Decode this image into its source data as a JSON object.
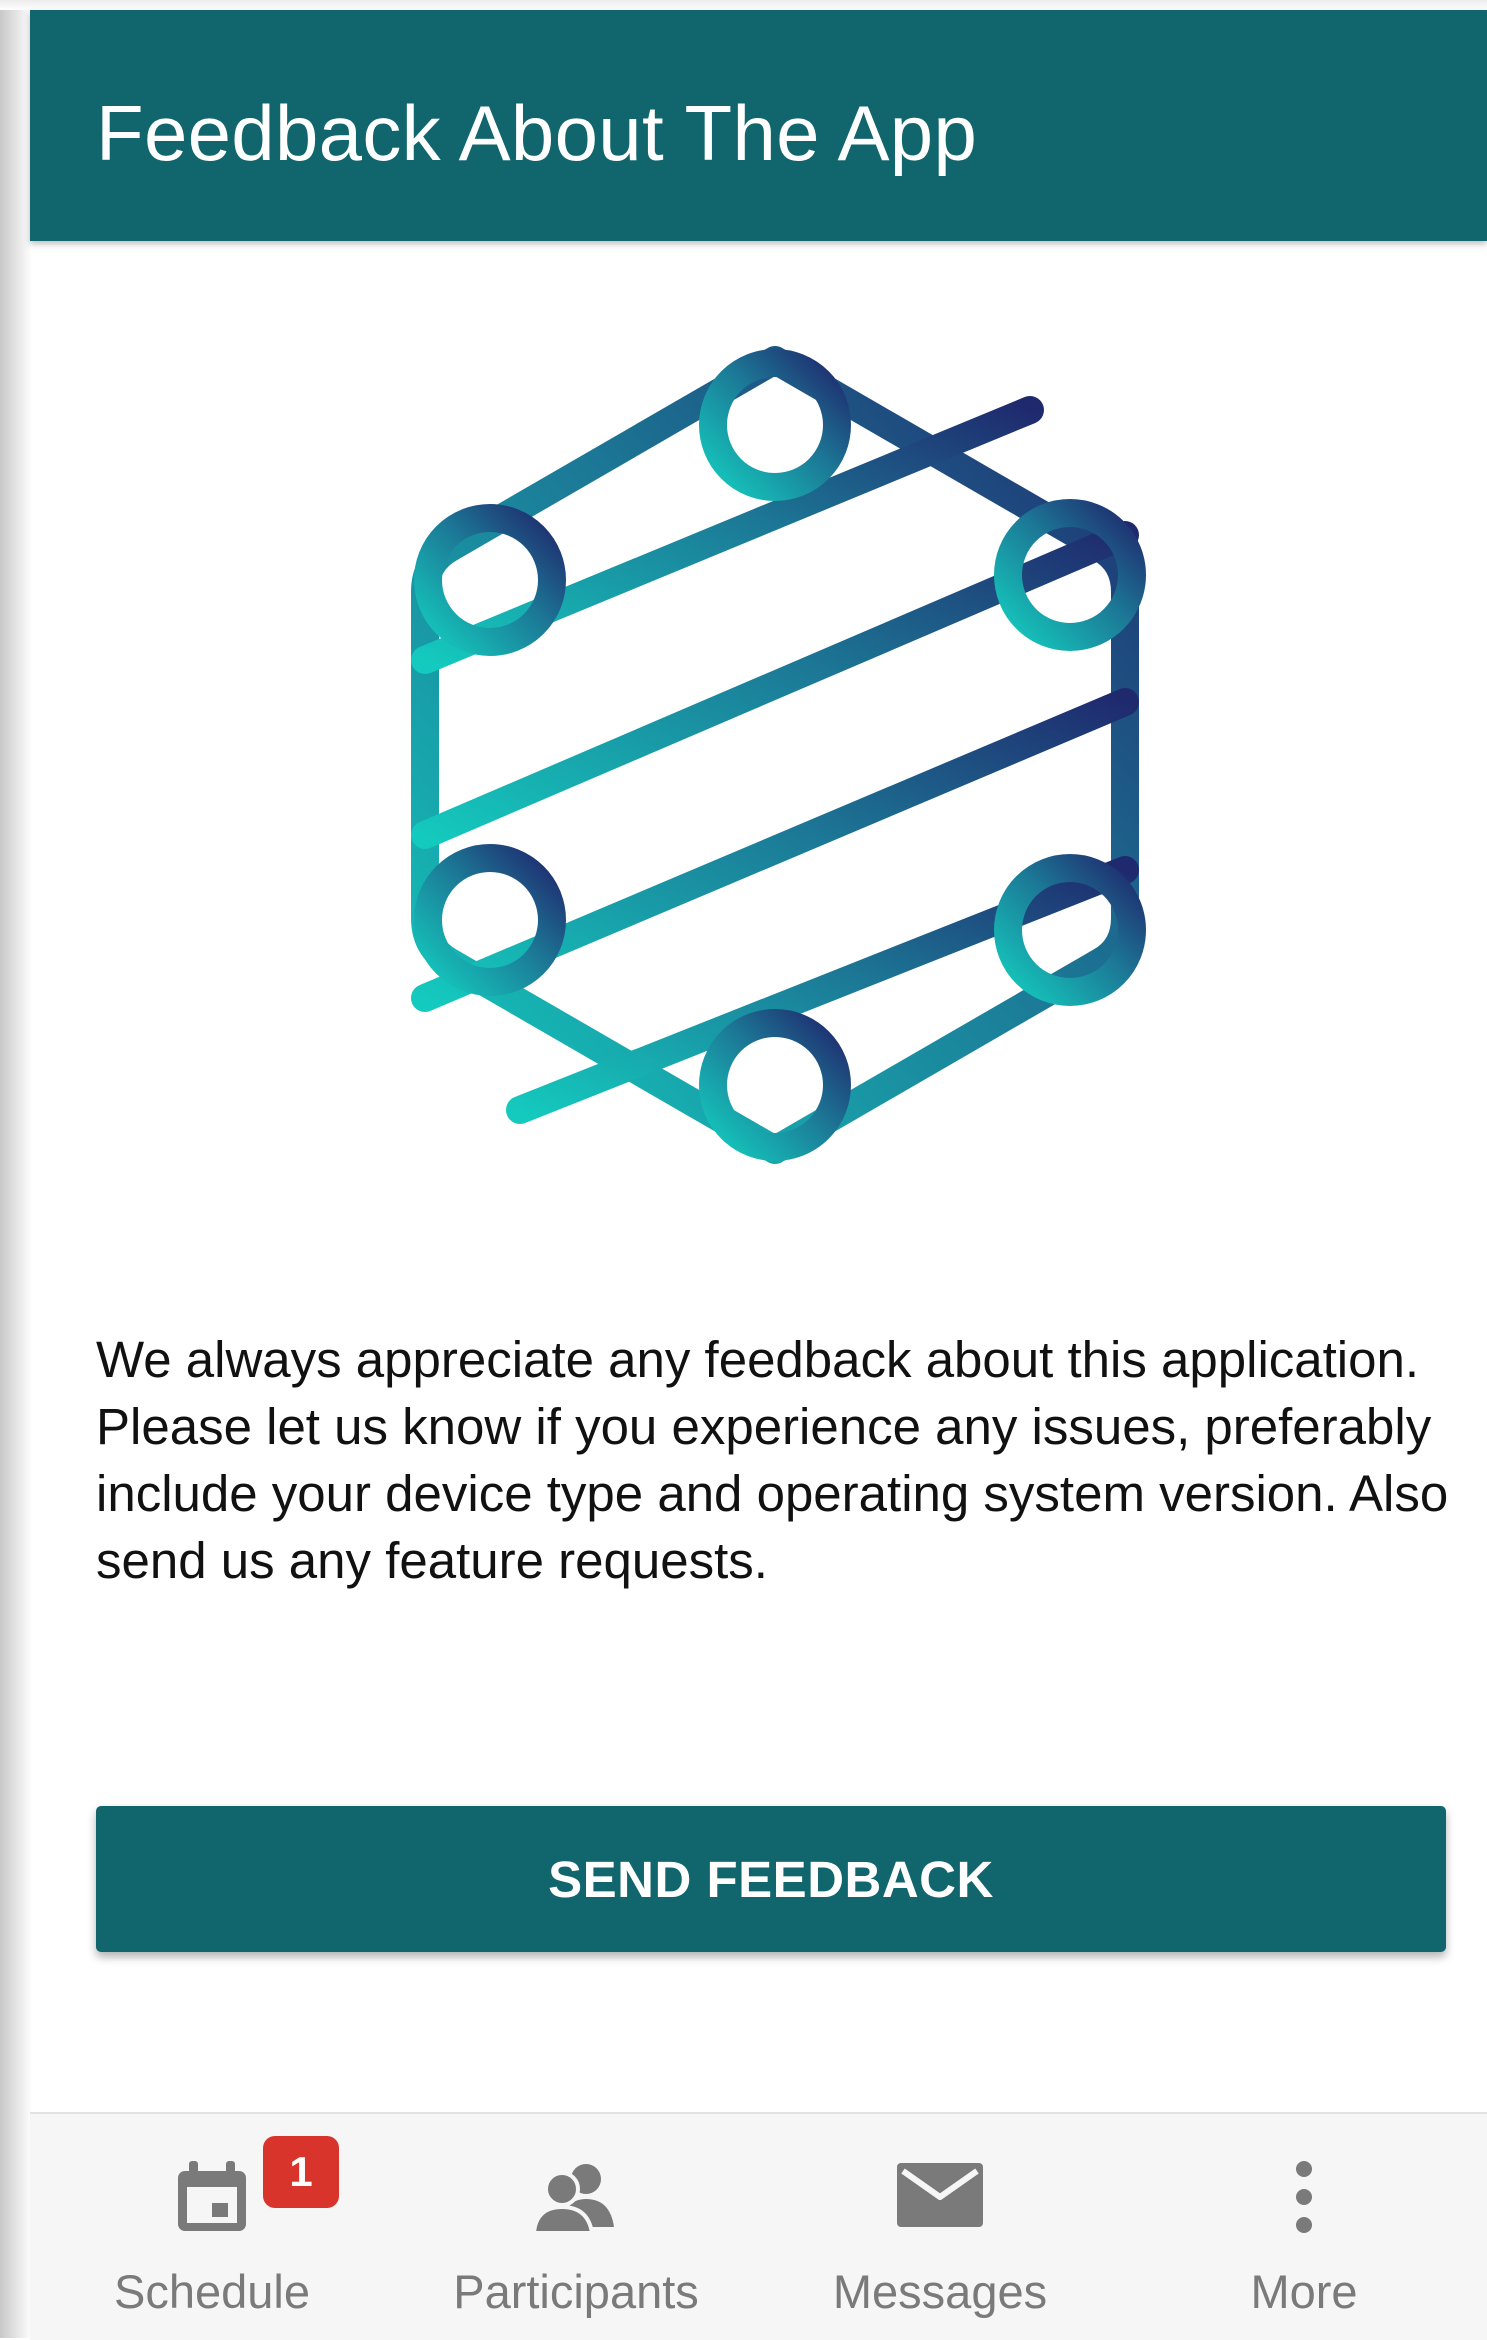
{
  "header": {
    "title": "Feedback About The App",
    "background_color": "#10666c"
  },
  "logo": {
    "icon": "hexagon-lattice-logo-icon",
    "gradient_colors": [
      "#14c9bd",
      "#1f2a6e"
    ]
  },
  "body": {
    "description": "We always appreciate any feedback about this application. Please let us know if you experience any issues, preferably include your device type and operating system version. Also send us any feature requests."
  },
  "actions": {
    "send_feedback_label": "SEND FEEDBACK"
  },
  "bottom_nav": {
    "items": [
      {
        "label": "Schedule",
        "icon": "calendar-icon",
        "badge": "1"
      },
      {
        "label": "Participants",
        "icon": "people-icon"
      },
      {
        "label": "Messages",
        "icon": "envelope-icon"
      },
      {
        "label": "More",
        "icon": "more-vertical-icon"
      }
    ],
    "badge_color": "#d9342b",
    "label_color": "#7a7a7a"
  }
}
